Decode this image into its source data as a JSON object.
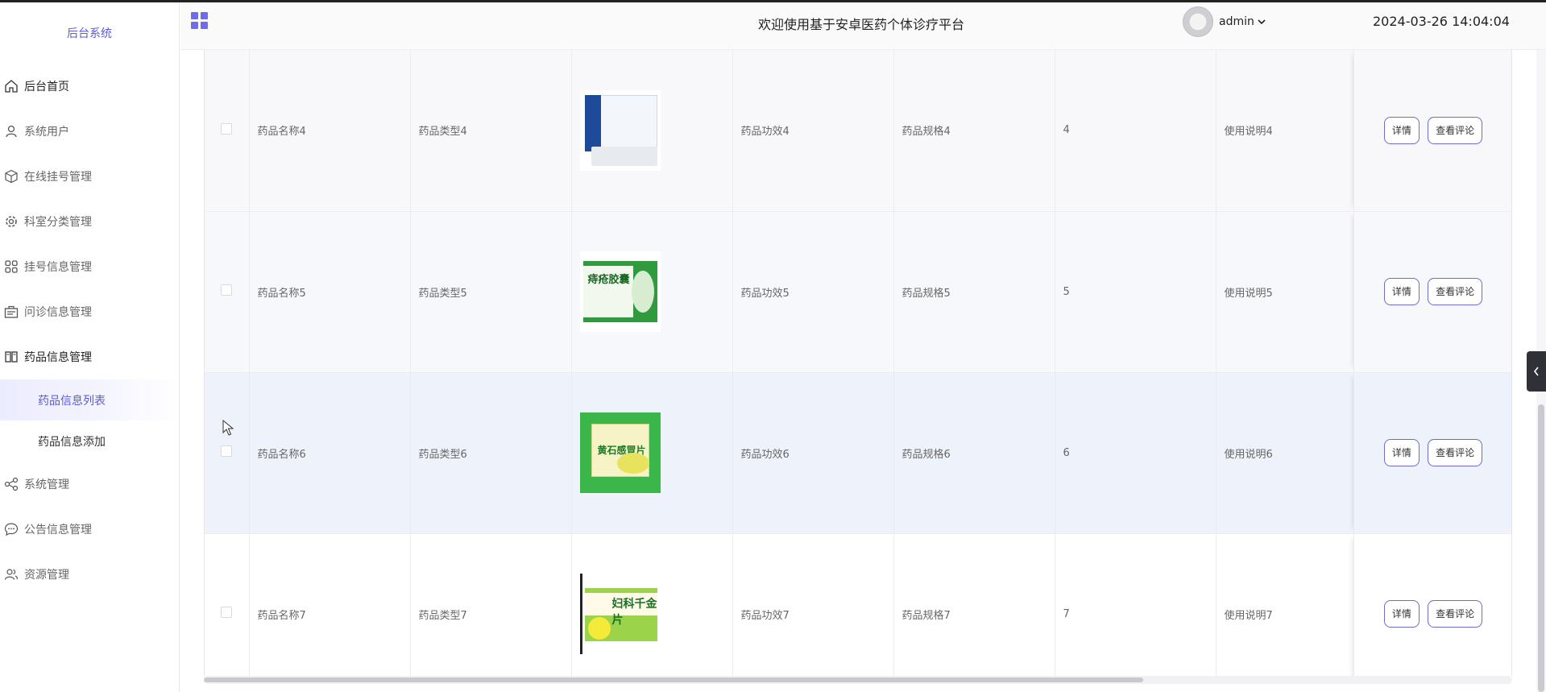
{
  "sidebar": {
    "brand": "后台系统",
    "items": [
      {
        "label": "后台首页",
        "icon": "home-icon"
      },
      {
        "label": "系统用户",
        "icon": "user-icon"
      },
      {
        "label": "在线挂号管理",
        "icon": "box-icon"
      },
      {
        "label": "科室分类管理",
        "icon": "gear-icon"
      },
      {
        "label": "挂号信息管理",
        "icon": "apps-icon"
      },
      {
        "label": "问诊信息管理",
        "icon": "clipboard-icon"
      },
      {
        "label": "药品信息管理",
        "icon": "book-icon"
      },
      {
        "label": "系统管理",
        "icon": "share-icon"
      },
      {
        "label": "公告信息管理",
        "icon": "chat-icon"
      },
      {
        "label": "资源管理",
        "icon": "users-icon"
      }
    ],
    "sub_items": [
      {
        "label": "药品信息列表",
        "current": true
      },
      {
        "label": "药品信息添加",
        "current": false
      }
    ]
  },
  "header": {
    "welcome": "欢迎使用基于安卓医药个体诊疗平台",
    "username": "admin",
    "datetime": "2024-03-26 14:04:04"
  },
  "table": {
    "rows": [
      {
        "name": "药品名称4",
        "type": "药品类型4",
        "image": "medicine-box-4",
        "effect": "药品功效4",
        "spec": "药品规格4",
        "number": "4",
        "usage": "使用说明4"
      },
      {
        "name": "药品名称5",
        "type": "药品类型5",
        "image": "medicine-box-5",
        "effect": "药品功效5",
        "spec": "药品规格5",
        "number": "5",
        "usage": "使用说明5"
      },
      {
        "name": "药品名称6",
        "type": "药品类型6",
        "image": "medicine-box-6",
        "effect": "药品功效6",
        "spec": "药品规格6",
        "number": "6",
        "usage": "使用说明6"
      },
      {
        "name": "药品名称7",
        "type": "药品类型7",
        "image": "medicine-box-7",
        "effect": "药品功效7",
        "spec": "药品规格7",
        "number": "7",
        "usage": "使用说明7"
      }
    ],
    "actions": {
      "detail": "详情",
      "comments": "查看评论"
    },
    "product_labels": {
      "p5": "痔疮胶囊",
      "p6": "黄石感冒片",
      "p7": "妇科千金片"
    }
  },
  "colors": {
    "accent": "#5b5bd6",
    "button_border": "#6b6bd0"
  }
}
